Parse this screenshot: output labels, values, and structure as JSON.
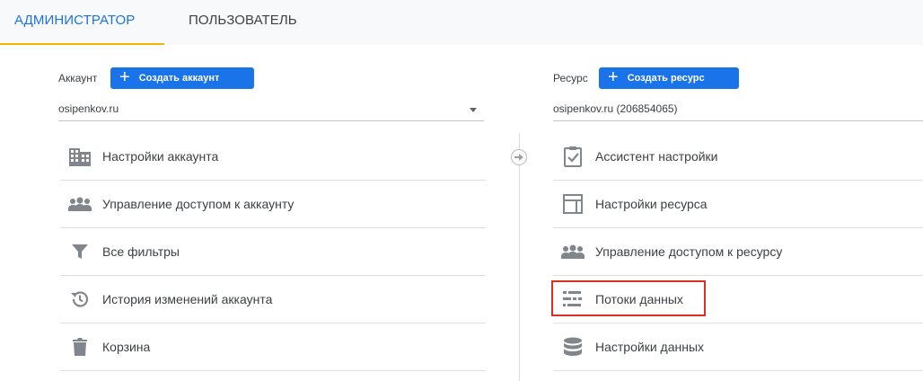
{
  "tabs": [
    {
      "label": "АДМИНИСТРАТОР",
      "active": true
    },
    {
      "label": "ПОЛЬЗОВАТЕЛЬ",
      "active": false
    }
  ],
  "account": {
    "label": "Аккаунт",
    "create_label": "Создать аккаунт",
    "selected": "osipenkov.ru",
    "items": [
      {
        "label": "Настройки аккаунта",
        "icon": "building-icon"
      },
      {
        "label": "Управление доступом к аккаунту",
        "icon": "people-icon"
      },
      {
        "label": "Все фильтры",
        "icon": "filter-icon"
      },
      {
        "label": "История изменений аккаунта",
        "icon": "history-icon"
      },
      {
        "label": "Корзина",
        "icon": "trash-icon"
      }
    ]
  },
  "property": {
    "label": "Ресурс",
    "create_label": "Создать ресурс",
    "selected": "osipenkov.ru (206854065)",
    "items": [
      {
        "label": "Ассистент настройки",
        "icon": "clipboard-check-icon"
      },
      {
        "label": "Настройки ресурса",
        "icon": "layout-icon"
      },
      {
        "label": "Управление доступом к ресурсу",
        "icon": "people-icon"
      },
      {
        "label": "Потоки данных",
        "icon": "data-streams-icon",
        "highlighted": true
      },
      {
        "label": "Настройки данных",
        "icon": "database-icon"
      }
    ]
  },
  "colors": {
    "accent": "#1a73e8",
    "tab_indicator": "#f4b400",
    "highlight": "#d93025",
    "icon": "#80868b"
  }
}
